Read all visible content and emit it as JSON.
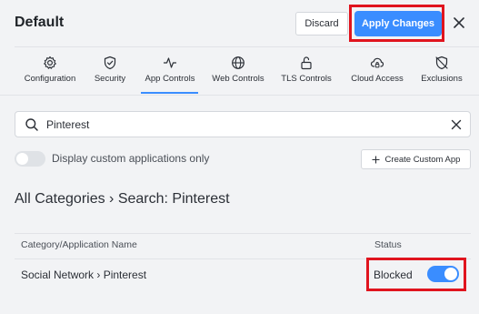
{
  "header": {
    "title": "Default",
    "discard_label": "Discard",
    "apply_label": "Apply Changes",
    "close_icon": "close-icon"
  },
  "tabs": [
    {
      "label": "Configuration",
      "icon": "gear-icon"
    },
    {
      "label": "Security",
      "icon": "shield-check-icon"
    },
    {
      "label": "App Controls",
      "icon": "activity-icon",
      "active": true
    },
    {
      "label": "Web Controls",
      "icon": "globe-icon"
    },
    {
      "label": "TLS Controls",
      "icon": "unlock-icon"
    },
    {
      "label": "Cloud Access",
      "icon": "cloud-lock-icon"
    },
    {
      "label": "Exclusions",
      "icon": "shield-off-icon"
    }
  ],
  "search": {
    "value": "Pinterest"
  },
  "filter": {
    "label": "Display custom applications only",
    "enabled": false
  },
  "create_button": {
    "label": "Create Custom App"
  },
  "breadcrumb": "All Categories › Search: Pinterest",
  "table": {
    "columns": [
      "Category/Application Name",
      "Status"
    ],
    "rows": [
      {
        "name": "Social Network › Pinterest",
        "status": "Blocked",
        "enabled": true
      }
    ]
  },
  "colors": {
    "accent": "#3a8dff",
    "highlight": "#e0141e"
  }
}
